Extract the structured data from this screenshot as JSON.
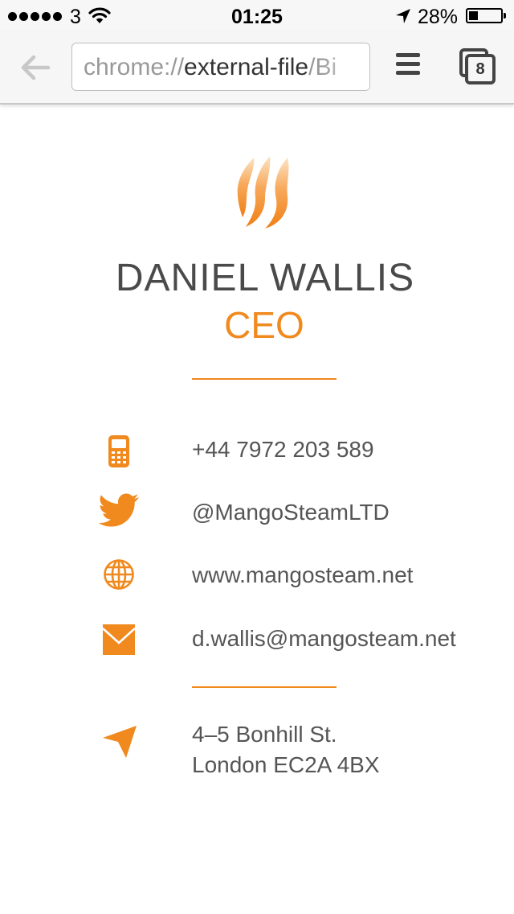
{
  "status_bar": {
    "carrier": "3",
    "time": "01:25",
    "battery_percent": "28%",
    "battery_level": 0.28,
    "signal_bars": 5,
    "icons": [
      "signal-dots-icon",
      "wifi-icon",
      "location-arrow-icon",
      "battery-icon"
    ]
  },
  "browser": {
    "url_scheme": "chrome://",
    "url_host": "external-file",
    "url_path": "/Bi",
    "open_tabs": "8",
    "icons": [
      "back-arrow-icon",
      "menu-icon",
      "tabs-icon"
    ]
  },
  "card": {
    "name": "DANIEL WALLIS",
    "title": "CEO",
    "accent_color": "#f0891e",
    "contacts": {
      "phone": "+44 7972 203 589",
      "twitter": "@MangoSteamLTD",
      "website": "www.mangosteam.net",
      "email": "d.wallis@mangosteam.net"
    },
    "address": {
      "line1": "4–5 Bonhill St.",
      "line2": "London EC2A 4BX"
    },
    "icons": [
      "flame-logo-icon",
      "phone-icon",
      "twitter-icon",
      "globe-icon",
      "mail-icon",
      "location-arrow-icon"
    ]
  }
}
